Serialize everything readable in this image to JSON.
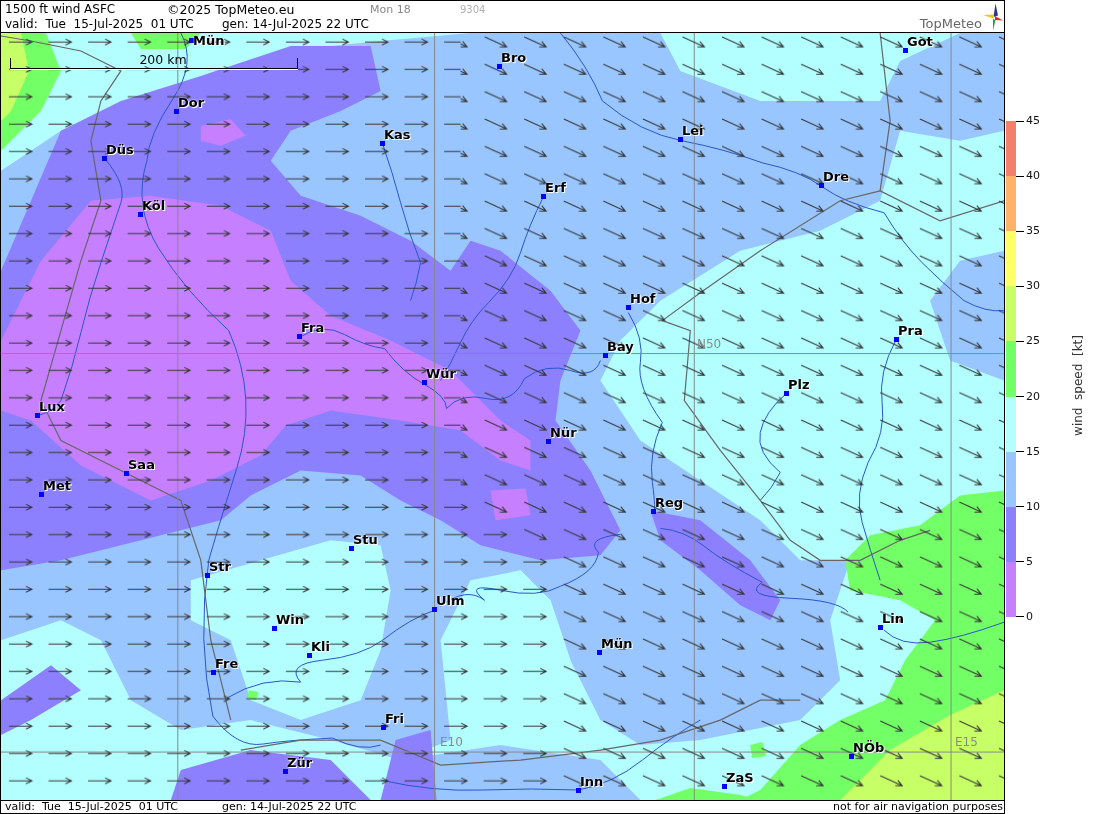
{
  "header": {
    "title": "1500 ft wind ASFC",
    "copyright": "©2025 TopMeteo.eu",
    "run": "Mon 18",
    "code": "9304",
    "valid": "valid:  Tue  15-Jul-2025  01 UTC",
    "generated": "gen: 14-Jul-2025 22 UTC",
    "logo_text": "TopMeteo"
  },
  "map": {
    "scale_label": "200 km",
    "grid_labels": [
      "N50",
      "E10",
      "E15"
    ],
    "cities": [
      "Mün",
      "Got",
      "Bro",
      "Dor",
      "Lei",
      "Kas",
      "Düs",
      "Dre",
      "Erf",
      "Köl",
      "Hof",
      "Fra",
      "Pra",
      "Bay",
      "Wür",
      "Plz",
      "Lux",
      "Nür",
      "Saa",
      "Met",
      "Reg",
      "Stu",
      "Str",
      "Ulm",
      "Lin",
      "Win",
      "Mün",
      "Kli",
      "Fre",
      "Fri",
      "NÖb",
      "Zür",
      "ZaS",
      "Inn"
    ]
  },
  "legend": {
    "title": "wind  speed  [kt]",
    "ticks": [
      "45",
      "40",
      "35",
      "30",
      "25",
      "20",
      "15",
      "10",
      "5",
      "0"
    ],
    "bands": [
      {
        "color": "#f3806a"
      },
      {
        "color": "#ffb366"
      },
      {
        "color": "#ffff66"
      },
      {
        "color": "#c6ff66"
      },
      {
        "color": "#73ff66"
      },
      {
        "color": "#b3ffff"
      },
      {
        "color": "#99c6ff"
      },
      {
        "color": "#8c80ff"
      },
      {
        "color": "#c680ff"
      }
    ]
  },
  "footer": {
    "valid": "valid:  Tue  15-Jul-2025  01 UTC",
    "generated": "gen: 14-Jul-2025 22 UTC",
    "disclaimer": "not for air navigation purposes"
  }
}
